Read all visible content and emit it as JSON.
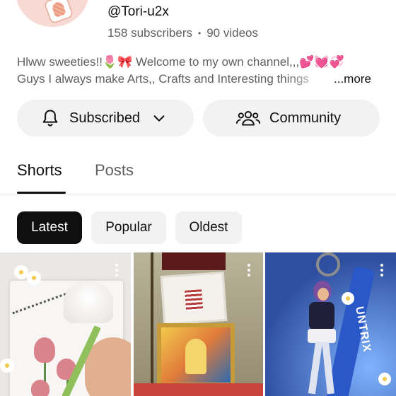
{
  "channel": {
    "handle": "@Tori-u2x",
    "subscribers": "158 subscribers",
    "separator": "•",
    "videos": "90 videos",
    "description_line1": "Hlww sweeties!!🌷🎀 Welcome to my own channel,,,💕💓💞",
    "description_line2": "Guys I always make Arts,, Crafts and Interesting things",
    "more_label": "...more"
  },
  "actions": {
    "subscribed_label": "Subscribed",
    "community_label": "Community"
  },
  "tabs": [
    {
      "label": "Shorts",
      "selected": true
    },
    {
      "label": "Posts",
      "selected": false
    }
  ],
  "filters": [
    {
      "label": "Latest",
      "selected": true
    },
    {
      "label": "Popular",
      "selected": false
    },
    {
      "label": "Oldest",
      "selected": false
    }
  ],
  "thumbnails": [
    {
      "subject": "painting tulips in a sketchbook",
      "overlay_text": ""
    },
    {
      "subject": "framed certificate and picture frame",
      "overlay_text": ""
    },
    {
      "subject": "anime figure keychain",
      "overlay_text": "UNTRIX"
    }
  ],
  "colors": {
    "text_primary": "#0f0f0f",
    "text_secondary": "#606060",
    "pill_bg": "#f2f2f2",
    "chip_selected_bg": "#0f0f0f"
  },
  "icons": [
    "bell-icon",
    "chevron-down-icon",
    "community-icon",
    "more-vert-icon"
  ]
}
